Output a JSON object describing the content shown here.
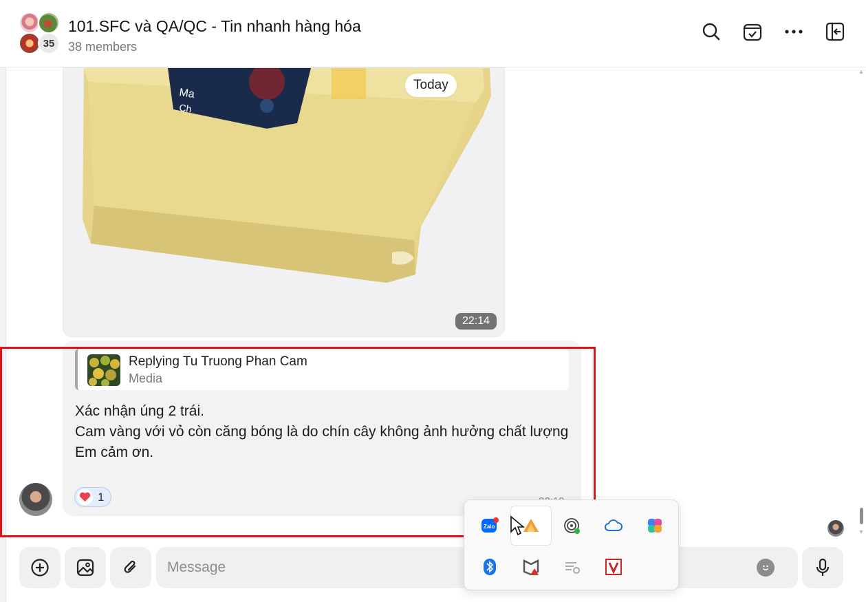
{
  "header": {
    "title": "101.SFC và QA/QC - Tin nhanh hàng hóa",
    "members": "38 members",
    "avatar_more_count": "35",
    "icons": [
      "search-icon",
      "task-icon",
      "more-icon",
      "sidebar-toggle-icon"
    ]
  },
  "conversation": {
    "date_divider": "Today",
    "image_message": {
      "time": "22:14"
    },
    "text_message": {
      "reply_title": "Replying Tu Truong Phan Cam",
      "reply_subtitle": "Media",
      "lines": [
        "Xác nhận úng 2 trái.",
        "Cam vàng với vỏ còn căng bóng là do chín cây không ảnh hưởng chất lượng",
        "Em cảm ơn."
      ],
      "reaction_count": "1",
      "time": "22:19"
    }
  },
  "composer": {
    "placeholder": "Message",
    "buttons": [
      "add-icon",
      "image-icon",
      "attach-icon",
      "emoji-icon",
      "mic-icon"
    ]
  },
  "tray": {
    "icons": [
      "zalo-icon",
      "app-orange-icon",
      "hotspot-icon",
      "cloud-icon",
      "copilot-icon",
      "bluetooth-icon",
      "mcafee-icon",
      "network-icon",
      "vector-v-icon"
    ]
  },
  "colors": {
    "accent_red": "#d9141c",
    "bubble": "#f2f2f2",
    "reaction_bg": "#e3edfb"
  }
}
